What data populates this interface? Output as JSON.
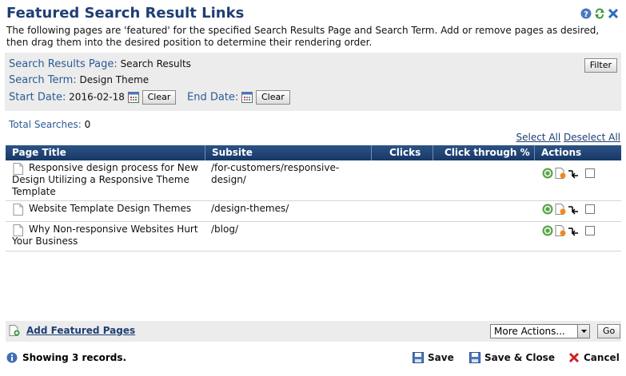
{
  "header": {
    "title": "Featured Search Result Links",
    "description": "The following pages are 'featured' for the specified Search Results Page and Search Term. Add or remove pages as desired, then drag them into the desired position to determine their rendering order."
  },
  "filter": {
    "results_page_label": "Search Results Page:",
    "results_page_value": "Search Results",
    "search_term_label": "Search Term:",
    "search_term_value": "Design Theme",
    "start_date_label": "Start Date:",
    "start_date_value": "2016-02-18",
    "end_date_label": "End Date:",
    "clear_label": "Clear",
    "filter_button": "Filter"
  },
  "summary": {
    "total_label": "Total Searches:",
    "total_value": "0",
    "select_all": "Select All",
    "deselect_all": "Deselect All"
  },
  "table": {
    "columns": [
      "Page Title",
      "Subsite",
      "Clicks",
      "Click through %",
      "Actions"
    ],
    "rows": [
      {
        "title": "Responsive design process for New Design Utilizing a Responsive Theme Template",
        "subsite": "/for-customers/responsive-design/"
      },
      {
        "title": "Website Template Design Themes",
        "subsite": "/design-themes/"
      },
      {
        "title": "Why Non-responsive Websites Hurt Your Business",
        "subsite": "/blog/"
      }
    ]
  },
  "footer": {
    "add_label": "Add Featured Pages",
    "more_actions": "More Actions...",
    "go": "Go",
    "status": "Showing 3 records.",
    "save": "Save",
    "save_close": "Save & Close",
    "cancel": "Cancel"
  },
  "colors": {
    "heading_blue": "#1f3f73",
    "label_blue": "#2a5b96",
    "table_header": "#1f4476",
    "panel_gray": "#ececec",
    "cancel_red": "#cc2222"
  },
  "icons": [
    "help-icon",
    "refresh-icon",
    "close-icon",
    "calendar-icon",
    "page-icon",
    "view-icon",
    "page-settings-icon",
    "link-icon",
    "add-page-icon",
    "info-icon",
    "save-icon",
    "cancel-icon"
  ]
}
